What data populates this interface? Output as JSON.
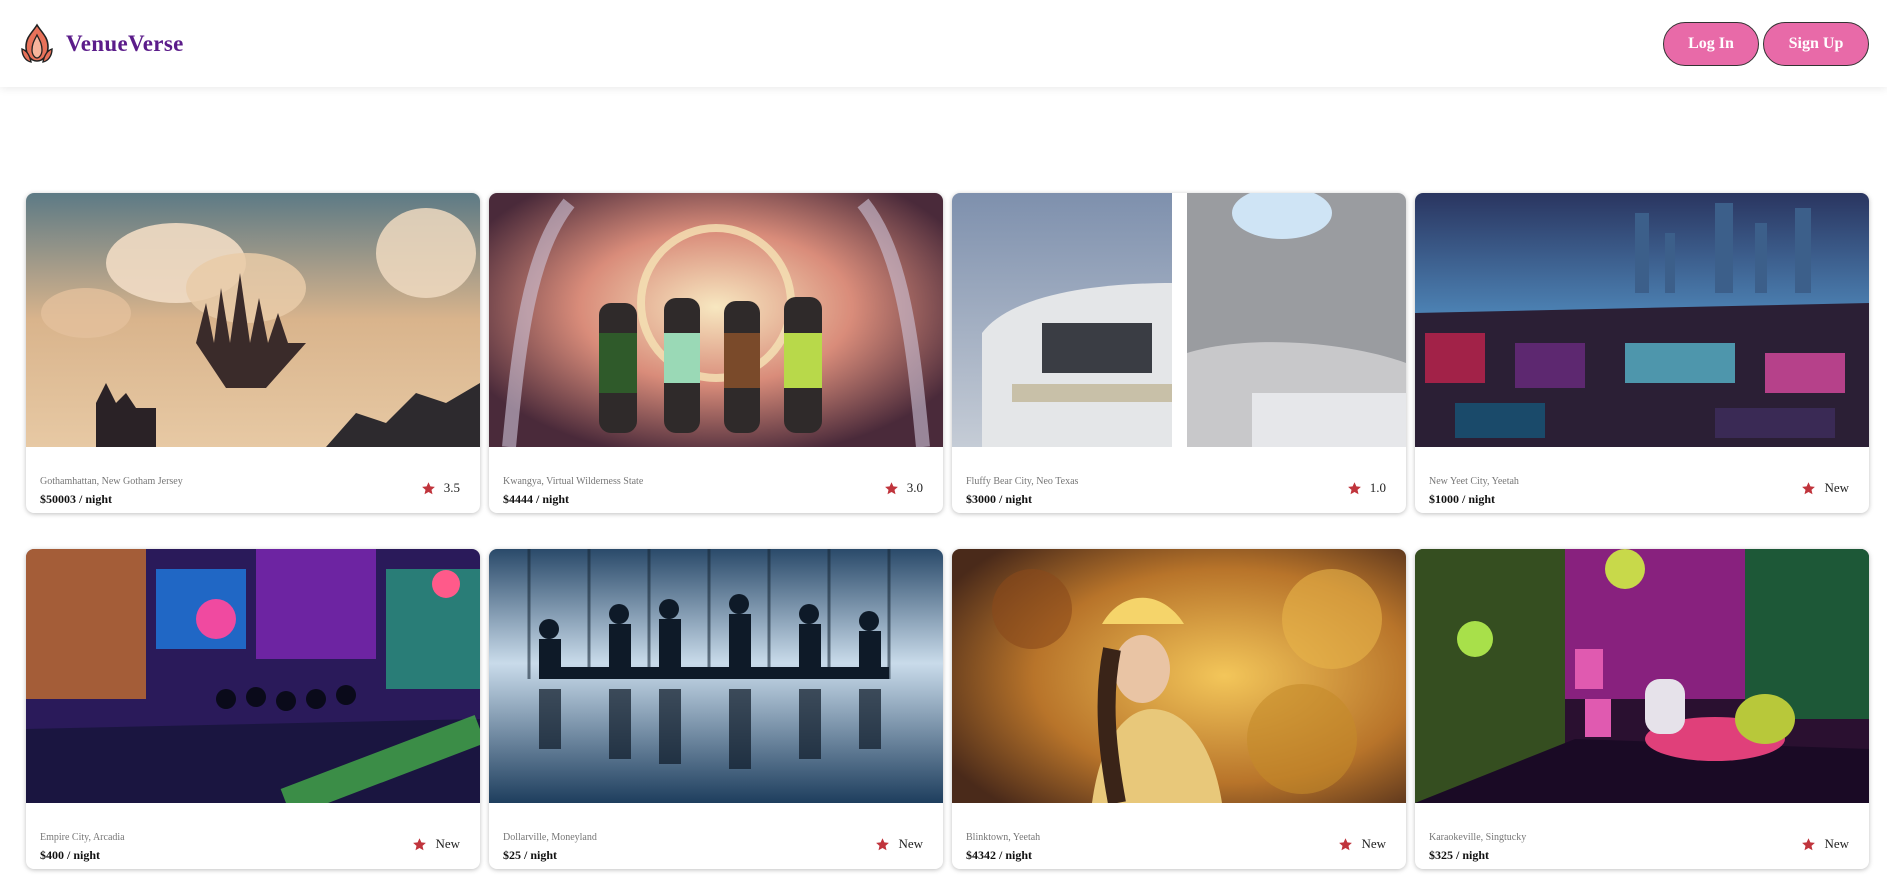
{
  "brand": {
    "name": "VenueVerse",
    "logo_icon": "flame-lotus-icon",
    "name_color": "#5b1c8a",
    "logo_color": "#e8725a"
  },
  "auth": {
    "login_label": "Log In",
    "signup_label": "Sign Up",
    "button_color": "#e86aa8"
  },
  "star_color": "#c0343c",
  "listings": [
    {
      "location": "Gothamhattan, New Gotham Jersey",
      "price": "$50003 / night",
      "rating": "3.5",
      "image": "floating-castle-in-clouds"
    },
    {
      "location": "Kwangya, Virtual Wilderness State",
      "price": "$4444 / night",
      "rating": "3.0",
      "image": "four-performers-on-stage"
    },
    {
      "location": "Fluffy Bear City, Neo Texas",
      "price": "$3000 / night",
      "rating": "1.0",
      "image": "curved-white-architecture"
    },
    {
      "location": "New Yeet City, Yeetah",
      "price": "$1000 / night",
      "rating": "New",
      "image": "neon-cyberpunk-city"
    },
    {
      "location": "Empire City, Arcadia",
      "price": "$400 / night",
      "rating": "New",
      "image": "neon-arcade-hall"
    },
    {
      "location": "Dollarville, Moneyland",
      "price": "$25 / night",
      "rating": "New",
      "image": "boardroom-silhouettes"
    },
    {
      "location": "Blinktown, Yeetah",
      "price": "$4342 / night",
      "rating": "New",
      "image": "golden-ornate-portrait"
    },
    {
      "location": "Karaokeville, Singtucky",
      "price": "$325 / night",
      "rating": "New",
      "image": "neon-karaoke-room"
    }
  ]
}
